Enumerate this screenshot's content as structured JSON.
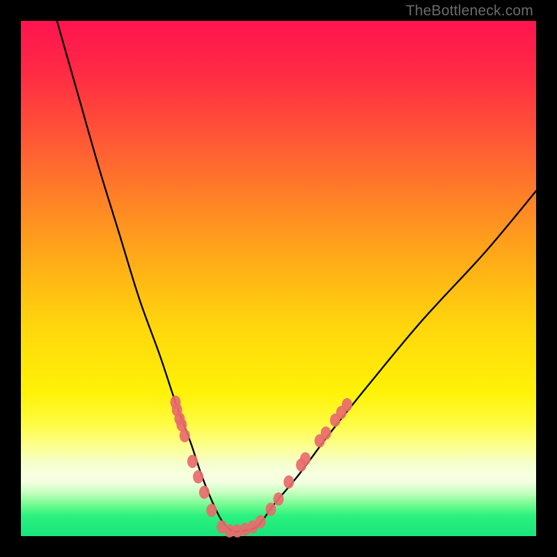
{
  "watermark": "TheBottleneck.com",
  "chart_data": {
    "type": "line",
    "title": "",
    "xlabel": "",
    "ylabel": "",
    "ylim": [
      0,
      100
    ],
    "xlim": [
      0,
      100
    ],
    "series": [
      {
        "name": "bottleneck-curve",
        "x": [
          7,
          11,
          15,
          19,
          23,
          27,
          30,
          33,
          35,
          37,
          39,
          41,
          43,
          46,
          49,
          54,
          60,
          68,
          78,
          90,
          100
        ],
        "y": [
          100,
          86,
          72,
          59,
          46,
          35,
          26,
          18,
          12,
          7,
          3,
          1,
          1,
          2,
          6,
          12,
          20,
          30,
          42,
          55,
          67
        ]
      }
    ],
    "markers": {
      "name": "highlight-dots",
      "color": "#e86b6b",
      "points": [
        {
          "x": 30.0,
          "y": 26.0
        },
        {
          "x": 30.3,
          "y": 24.5
        },
        {
          "x": 30.8,
          "y": 22.8
        },
        {
          "x": 31.2,
          "y": 21.6
        },
        {
          "x": 31.8,
          "y": 19.5
        },
        {
          "x": 33.3,
          "y": 14.5
        },
        {
          "x": 34.4,
          "y": 11.5
        },
        {
          "x": 35.6,
          "y": 8.5
        },
        {
          "x": 37.0,
          "y": 5.0
        },
        {
          "x": 39.0,
          "y": 1.8
        },
        {
          "x": 40.5,
          "y": 1.0
        },
        {
          "x": 42.0,
          "y": 1.0
        },
        {
          "x": 43.5,
          "y": 1.3
        },
        {
          "x": 45.0,
          "y": 1.8
        },
        {
          "x": 46.5,
          "y": 2.8
        },
        {
          "x": 48.5,
          "y": 5.2
        },
        {
          "x": 50.0,
          "y": 7.2
        },
        {
          "x": 52.0,
          "y": 10.5
        },
        {
          "x": 54.4,
          "y": 13.8
        },
        {
          "x": 55.2,
          "y": 15.0
        },
        {
          "x": 58.0,
          "y": 18.5
        },
        {
          "x": 59.2,
          "y": 20.0
        },
        {
          "x": 61.0,
          "y": 22.5
        },
        {
          "x": 62.2,
          "y": 24.0
        },
        {
          "x": 63.3,
          "y": 25.5
        }
      ]
    },
    "gradient_stops": [
      {
        "pos": 0.0,
        "color": "#ff1450"
      },
      {
        "pos": 0.5,
        "color": "#ffd80c"
      },
      {
        "pos": 0.86,
        "color": "#f5ffce"
      },
      {
        "pos": 1.0,
        "color": "#18e57a"
      }
    ]
  }
}
